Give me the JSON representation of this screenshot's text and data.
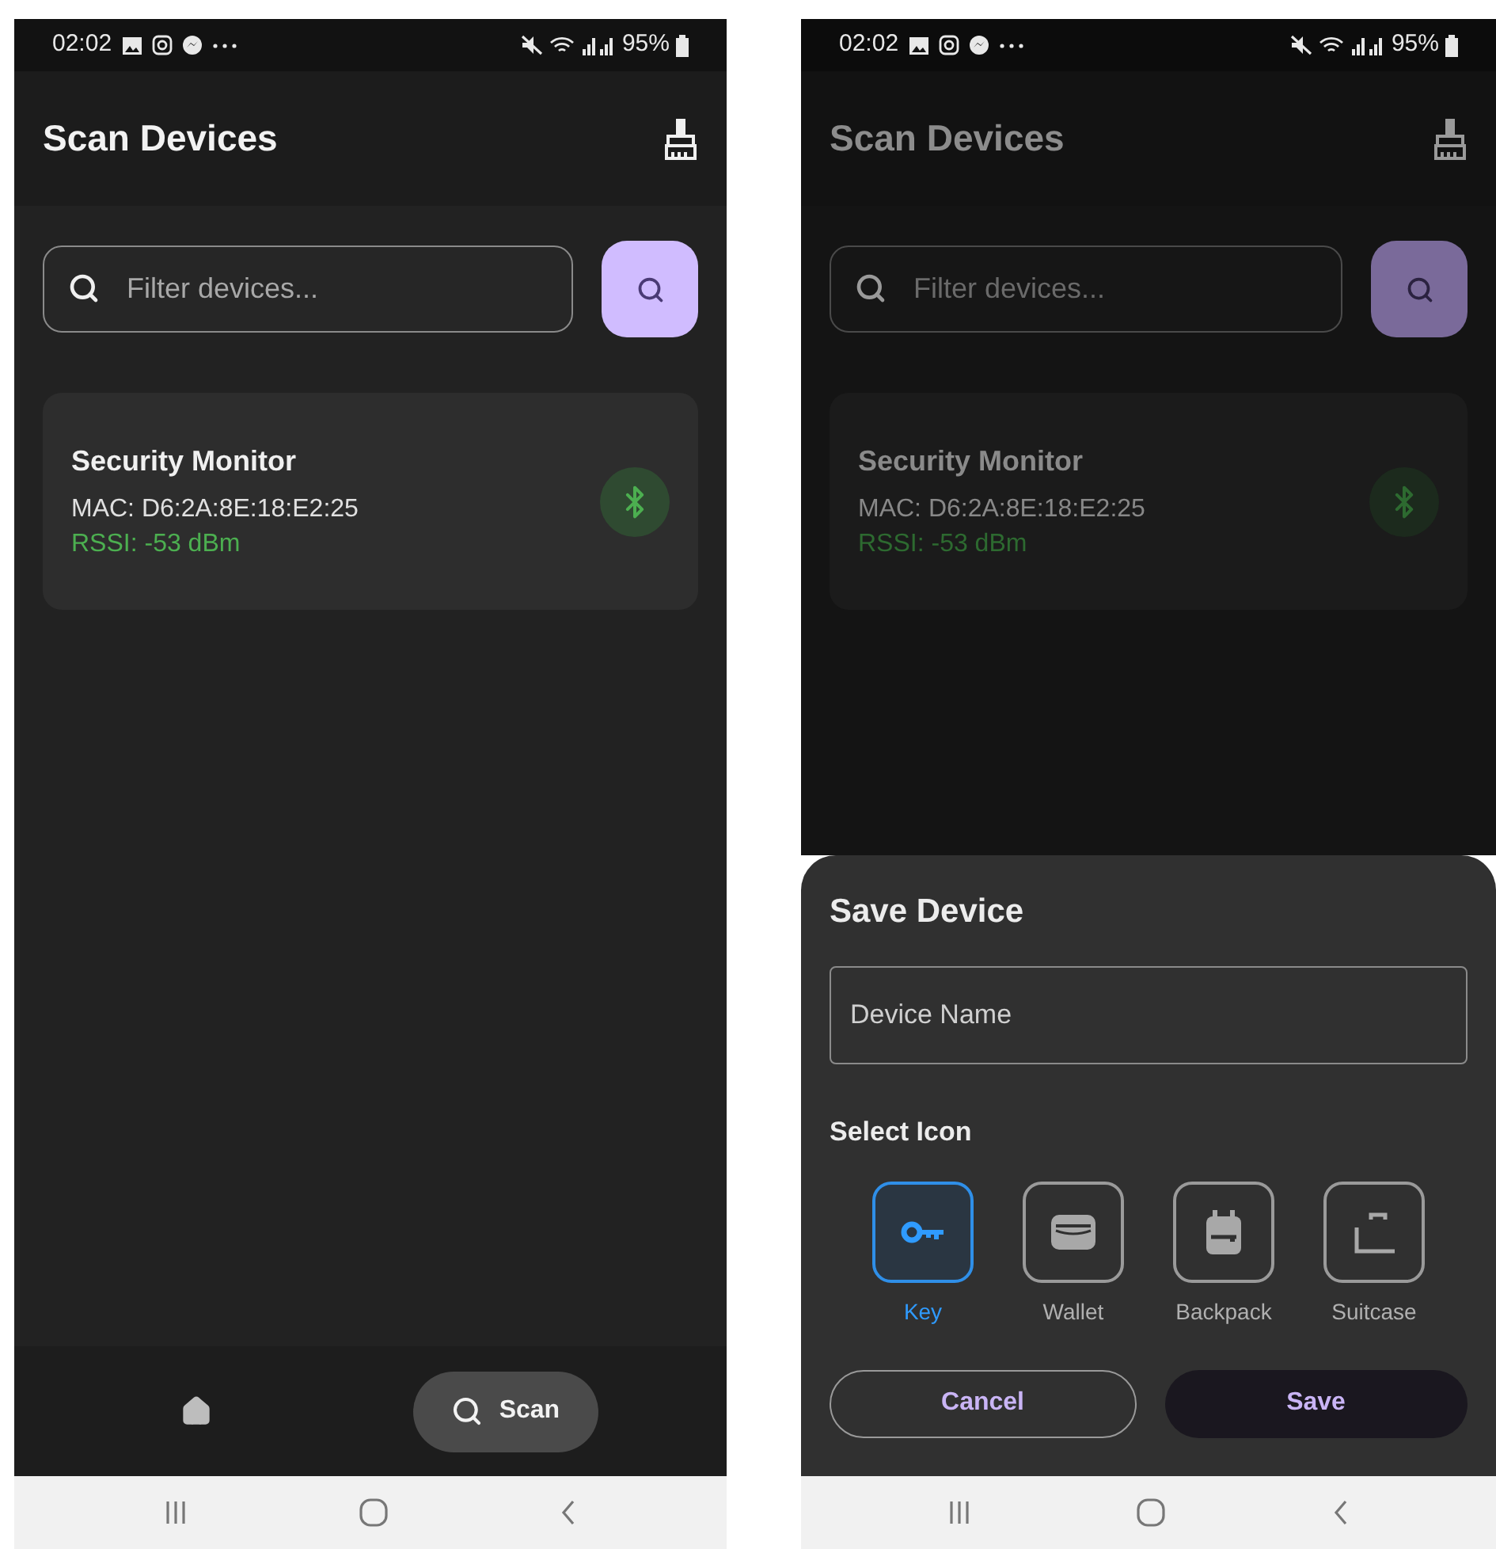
{
  "screens": [
    {
      "dimmed": false,
      "status_bar": {
        "time": "02:02",
        "battery": "95%"
      },
      "app_bar": {
        "title": "Scan Devices"
      },
      "search": {
        "placeholder": "Filter devices..."
      },
      "devices": [
        {
          "name": "Security Monitor",
          "mac": "MAC: D6:2A:8E:18:E2:25",
          "rssi": "RSSI: -53 dBm"
        }
      ],
      "bottom_nav": [
        {
          "kind": "home",
          "selected": false
        },
        {
          "kind": "scan",
          "label": "Scan",
          "selected": true
        }
      ]
    },
    {
      "dimmed": true,
      "status_bar": {
        "time": "02:02",
        "battery": "95%"
      },
      "app_bar": {
        "title": "Scan Devices"
      },
      "search": {
        "placeholder": "Filter devices..."
      },
      "devices": [
        {
          "name": "Security Monitor",
          "mac": "MAC: D6:2A:8E:18:E2:25",
          "rssi": "RSSI: -53 dBm"
        }
      ],
      "sheet": {
        "title": "Save Device",
        "field": {
          "placeholder": "Device Name"
        },
        "section": "Select Icon",
        "icons": [
          {
            "kind": "key",
            "label": "Key",
            "selected": true
          },
          {
            "kind": "wallet",
            "label": "Wallet",
            "selected": false
          },
          {
            "kind": "backpack",
            "label": "Backpack",
            "selected": false
          },
          {
            "kind": "suitcase",
            "label": "Suitcase",
            "selected": false
          }
        ],
        "buttons": [
          {
            "kind": "outline",
            "label": "Cancel"
          },
          {
            "kind": "filled",
            "label": "Save"
          }
        ]
      }
    }
  ]
}
